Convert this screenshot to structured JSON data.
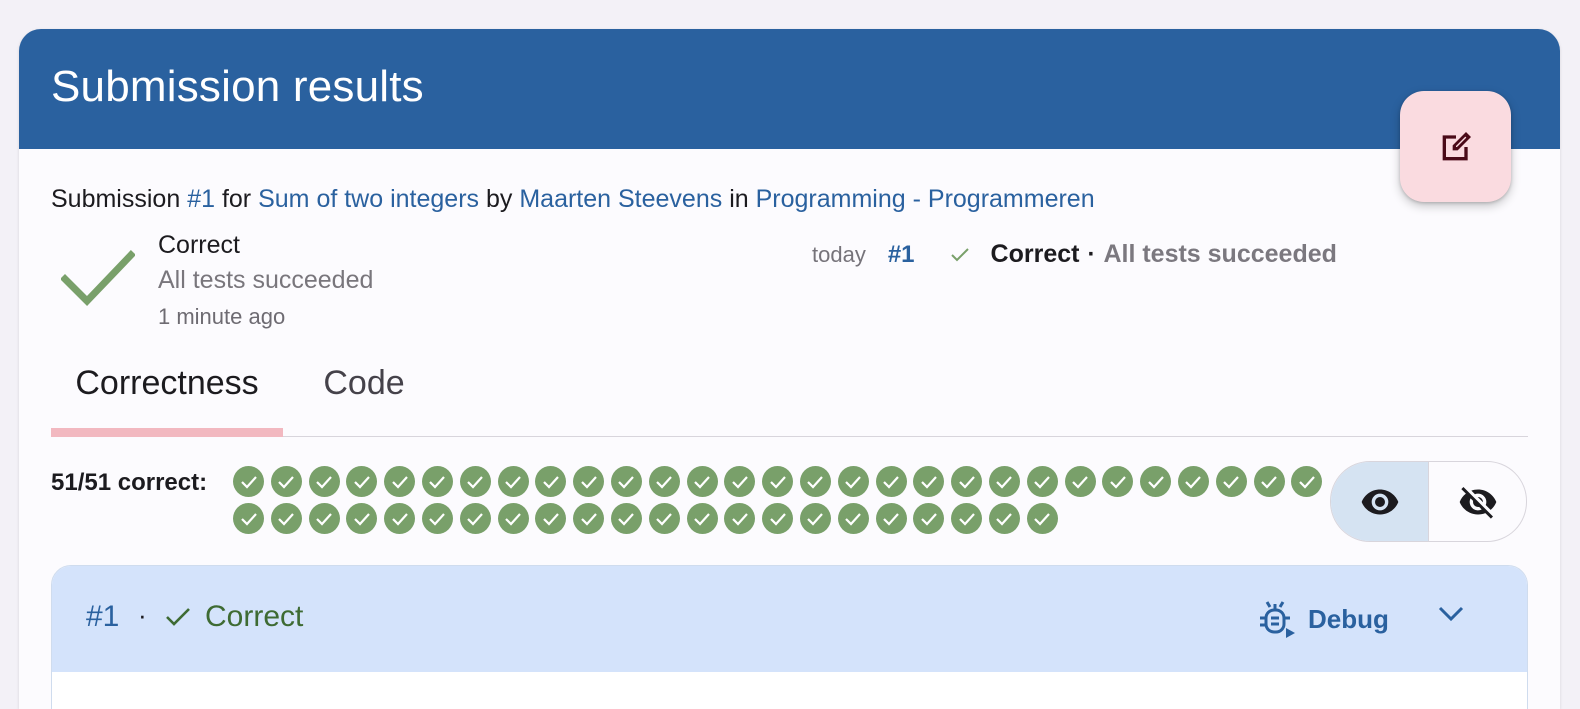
{
  "card": {
    "title": "Submission results"
  },
  "fab": {
    "icon": "edit-icon",
    "background": "#fadbe0"
  },
  "description": {
    "prefix": "Submission",
    "submission_link": "#1",
    "for_text": "for",
    "exercise_link": "Sum of two integers",
    "by_text": "by",
    "user_link": "Maarten Steevens",
    "in_text": "in",
    "course_link": "Programming - Programmeren"
  },
  "status": {
    "title": "Correct",
    "summary": "All tests succeeded",
    "time": "1 minute ago",
    "icon": "check-icon",
    "color": "#79a06a"
  },
  "history": {
    "when": "today",
    "number": "#1",
    "status": "Correct",
    "separator": "·",
    "summary": "All tests succeeded"
  },
  "tabs": [
    {
      "label": "Correctness",
      "active": true
    },
    {
      "label": "Code",
      "active": false
    }
  ],
  "tests": {
    "label": "51/51 correct:",
    "total": 51,
    "passed": 51
  },
  "visibility_toggle": {
    "options": [
      "eye-icon",
      "eye-off-icon"
    ],
    "selected": "eye-icon"
  },
  "test_case": {
    "number": "#1",
    "separator": "·",
    "status": "Correct",
    "debug_label": "Debug"
  },
  "colors": {
    "primary": "#2a619f",
    "success": "#79a06a",
    "tab_indicator": "#f2b8c0",
    "test_header": "#d4e3fb"
  }
}
